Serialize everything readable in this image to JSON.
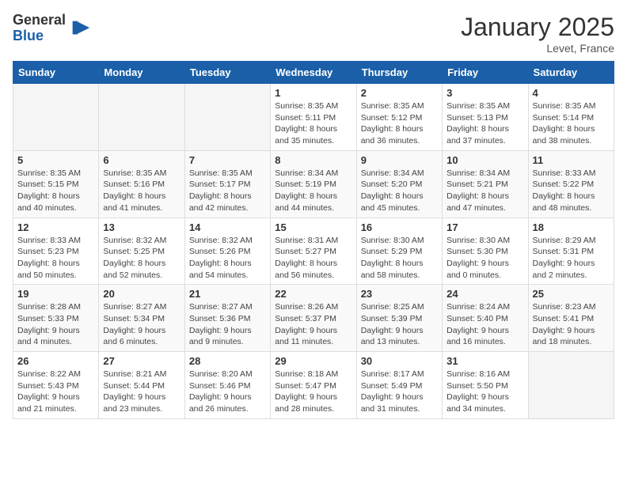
{
  "logo": {
    "general": "General",
    "blue": "Blue"
  },
  "header": {
    "month_year": "January 2025",
    "location": "Levet, France"
  },
  "weekdays": [
    "Sunday",
    "Monday",
    "Tuesday",
    "Wednesday",
    "Thursday",
    "Friday",
    "Saturday"
  ],
  "weeks": [
    [
      {
        "day": "",
        "info": ""
      },
      {
        "day": "",
        "info": ""
      },
      {
        "day": "",
        "info": ""
      },
      {
        "day": "1",
        "info": "Sunrise: 8:35 AM\nSunset: 5:11 PM\nDaylight: 8 hours\nand 35 minutes."
      },
      {
        "day": "2",
        "info": "Sunrise: 8:35 AM\nSunset: 5:12 PM\nDaylight: 8 hours\nand 36 minutes."
      },
      {
        "day": "3",
        "info": "Sunrise: 8:35 AM\nSunset: 5:13 PM\nDaylight: 8 hours\nand 37 minutes."
      },
      {
        "day": "4",
        "info": "Sunrise: 8:35 AM\nSunset: 5:14 PM\nDaylight: 8 hours\nand 38 minutes."
      }
    ],
    [
      {
        "day": "5",
        "info": "Sunrise: 8:35 AM\nSunset: 5:15 PM\nDaylight: 8 hours\nand 40 minutes."
      },
      {
        "day": "6",
        "info": "Sunrise: 8:35 AM\nSunset: 5:16 PM\nDaylight: 8 hours\nand 41 minutes."
      },
      {
        "day": "7",
        "info": "Sunrise: 8:35 AM\nSunset: 5:17 PM\nDaylight: 8 hours\nand 42 minutes."
      },
      {
        "day": "8",
        "info": "Sunrise: 8:34 AM\nSunset: 5:19 PM\nDaylight: 8 hours\nand 44 minutes."
      },
      {
        "day": "9",
        "info": "Sunrise: 8:34 AM\nSunset: 5:20 PM\nDaylight: 8 hours\nand 45 minutes."
      },
      {
        "day": "10",
        "info": "Sunrise: 8:34 AM\nSunset: 5:21 PM\nDaylight: 8 hours\nand 47 minutes."
      },
      {
        "day": "11",
        "info": "Sunrise: 8:33 AM\nSunset: 5:22 PM\nDaylight: 8 hours\nand 48 minutes."
      }
    ],
    [
      {
        "day": "12",
        "info": "Sunrise: 8:33 AM\nSunset: 5:23 PM\nDaylight: 8 hours\nand 50 minutes."
      },
      {
        "day": "13",
        "info": "Sunrise: 8:32 AM\nSunset: 5:25 PM\nDaylight: 8 hours\nand 52 minutes."
      },
      {
        "day": "14",
        "info": "Sunrise: 8:32 AM\nSunset: 5:26 PM\nDaylight: 8 hours\nand 54 minutes."
      },
      {
        "day": "15",
        "info": "Sunrise: 8:31 AM\nSunset: 5:27 PM\nDaylight: 8 hours\nand 56 minutes."
      },
      {
        "day": "16",
        "info": "Sunrise: 8:30 AM\nSunset: 5:29 PM\nDaylight: 8 hours\nand 58 minutes."
      },
      {
        "day": "17",
        "info": "Sunrise: 8:30 AM\nSunset: 5:30 PM\nDaylight: 9 hours\nand 0 minutes."
      },
      {
        "day": "18",
        "info": "Sunrise: 8:29 AM\nSunset: 5:31 PM\nDaylight: 9 hours\nand 2 minutes."
      }
    ],
    [
      {
        "day": "19",
        "info": "Sunrise: 8:28 AM\nSunset: 5:33 PM\nDaylight: 9 hours\nand 4 minutes."
      },
      {
        "day": "20",
        "info": "Sunrise: 8:27 AM\nSunset: 5:34 PM\nDaylight: 9 hours\nand 6 minutes."
      },
      {
        "day": "21",
        "info": "Sunrise: 8:27 AM\nSunset: 5:36 PM\nDaylight: 9 hours\nand 9 minutes."
      },
      {
        "day": "22",
        "info": "Sunrise: 8:26 AM\nSunset: 5:37 PM\nDaylight: 9 hours\nand 11 minutes."
      },
      {
        "day": "23",
        "info": "Sunrise: 8:25 AM\nSunset: 5:39 PM\nDaylight: 9 hours\nand 13 minutes."
      },
      {
        "day": "24",
        "info": "Sunrise: 8:24 AM\nSunset: 5:40 PM\nDaylight: 9 hours\nand 16 minutes."
      },
      {
        "day": "25",
        "info": "Sunrise: 8:23 AM\nSunset: 5:41 PM\nDaylight: 9 hours\nand 18 minutes."
      }
    ],
    [
      {
        "day": "26",
        "info": "Sunrise: 8:22 AM\nSunset: 5:43 PM\nDaylight: 9 hours\nand 21 minutes."
      },
      {
        "day": "27",
        "info": "Sunrise: 8:21 AM\nSunset: 5:44 PM\nDaylight: 9 hours\nand 23 minutes."
      },
      {
        "day": "28",
        "info": "Sunrise: 8:20 AM\nSunset: 5:46 PM\nDaylight: 9 hours\nand 26 minutes."
      },
      {
        "day": "29",
        "info": "Sunrise: 8:18 AM\nSunset: 5:47 PM\nDaylight: 9 hours\nand 28 minutes."
      },
      {
        "day": "30",
        "info": "Sunrise: 8:17 AM\nSunset: 5:49 PM\nDaylight: 9 hours\nand 31 minutes."
      },
      {
        "day": "31",
        "info": "Sunrise: 8:16 AM\nSunset: 5:50 PM\nDaylight: 9 hours\nand 34 minutes."
      },
      {
        "day": "",
        "info": ""
      }
    ]
  ]
}
